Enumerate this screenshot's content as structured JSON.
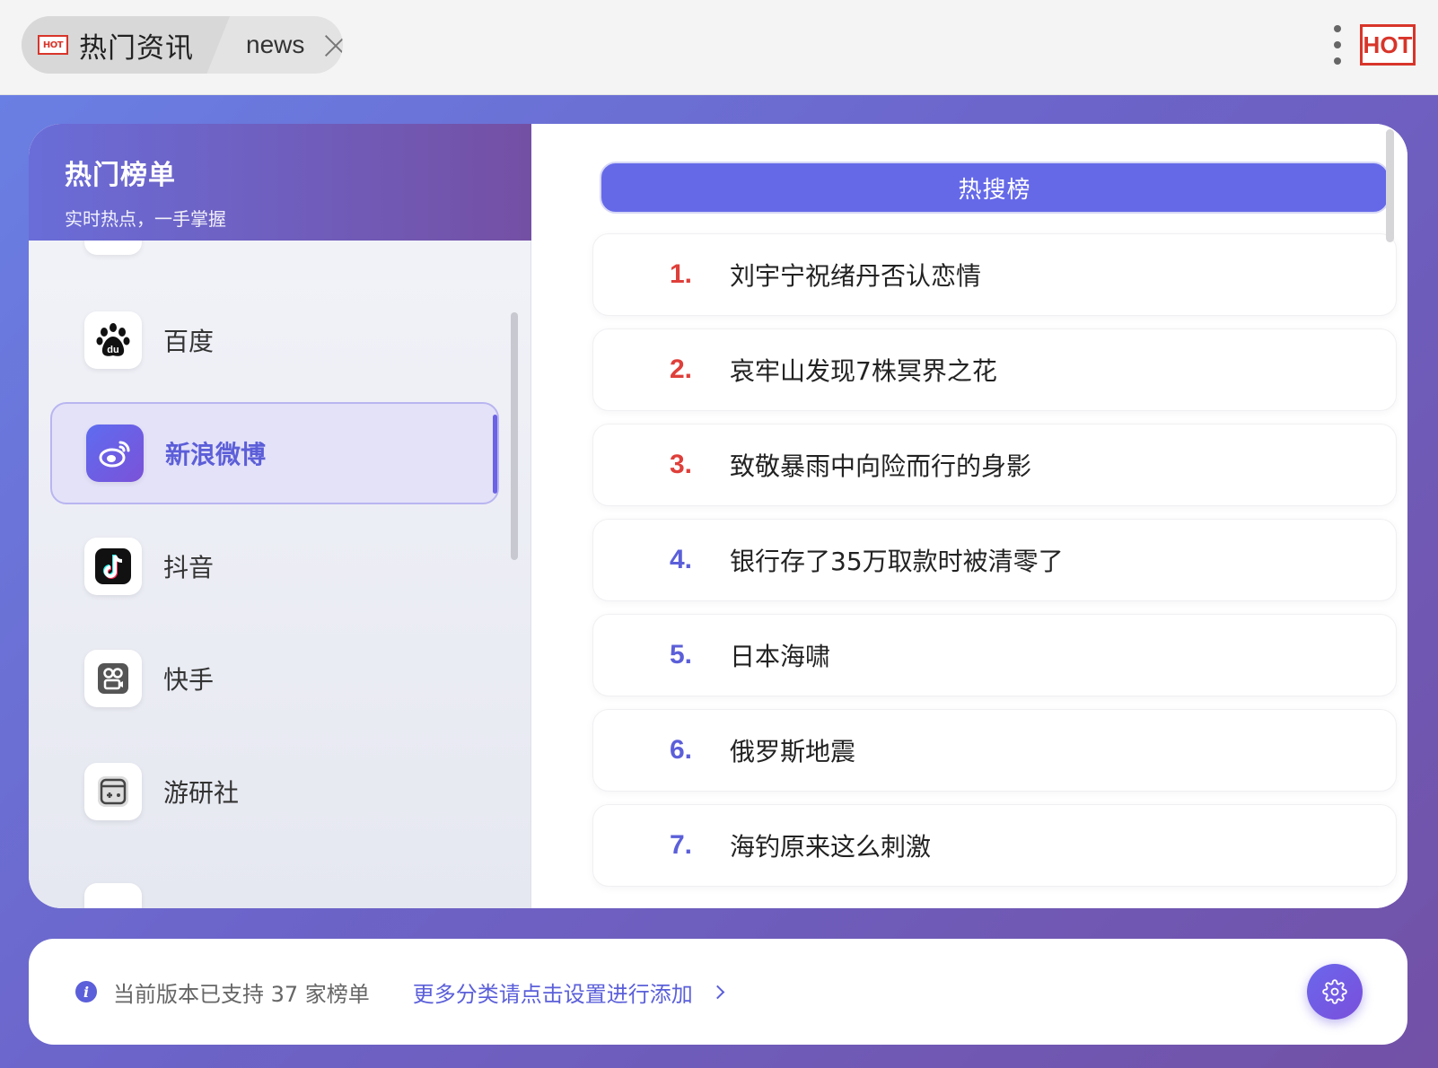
{
  "window": {
    "tab_active_badge": "HOT",
    "tab_active_label": "热门资讯",
    "tab_second_label": "news",
    "corner_badge": "HOT"
  },
  "sidebar": {
    "title": "热门榜单",
    "subtitle": "实时热点，一手掌握",
    "items": [
      {
        "label": "百度",
        "icon": "baidu-paw-icon"
      },
      {
        "label": "新浪微博",
        "icon": "weibo-icon",
        "active": true
      },
      {
        "label": "抖音",
        "icon": "douyin-icon"
      },
      {
        "label": "快手",
        "icon": "kuaishou-icon"
      },
      {
        "label": "游研社",
        "icon": "gamepad-icon"
      }
    ]
  },
  "main": {
    "tab_label": "热搜榜",
    "news": [
      {
        "rank": "1.",
        "title": "刘宇宁祝绪丹否认恋情"
      },
      {
        "rank": "2.",
        "title": "哀牢山发现7株冥界之花"
      },
      {
        "rank": "3.",
        "title": "致敬暴雨中向险而行的身影"
      },
      {
        "rank": "4.",
        "title": "银行存了35万取款时被清零了"
      },
      {
        "rank": "5.",
        "title": "日本海啸"
      },
      {
        "rank": "6.",
        "title": "俄罗斯地震"
      },
      {
        "rank": "7.",
        "title": "海钓原来这么刺激"
      }
    ]
  },
  "footer": {
    "info_icon_glyph": "i",
    "support_text": "当前版本已支持 37 家榜单",
    "more_link": "更多分类请点击设置进行添加"
  },
  "colors": {
    "accent": "#6569e8",
    "rank_top": "#df3f3a",
    "rank_rest": "#5b5fd9",
    "hot_red": "#d8352a"
  }
}
